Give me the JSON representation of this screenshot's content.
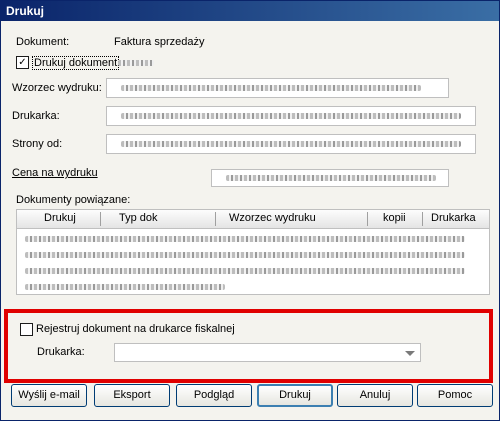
{
  "window": {
    "title": "Drukuj"
  },
  "document": {
    "label": "Dokument:",
    "value": "Faktura sprzedaży"
  },
  "print_document": {
    "label": "Drukuj dokument",
    "checked": true,
    "check_glyph": "✓"
  },
  "template": {
    "label": "Wzorzec wydruku:"
  },
  "printer": {
    "label": "Drukarka:"
  },
  "pages": {
    "label": "Strony od:"
  },
  "price_link": {
    "label": "Cena na wydruku"
  },
  "related_docs": {
    "label": "Dokumenty powiązane:",
    "columns": [
      "Drukuj",
      "Typ dok",
      "Wzorzec wydruku",
      "kopii",
      "Drukarka"
    ]
  },
  "fiscal": {
    "checkbox_label": "Rejestruj dokument na drukarce fiskalnej",
    "checked": false,
    "printer_label": "Drukarka:",
    "printer_value": ""
  },
  "buttons": {
    "email": "Wyślij e-mail",
    "export": "Eksport",
    "preview": "Podgląd",
    "print": "Drukuj",
    "cancel": "Anuluj",
    "help": "Pomoc"
  },
  "colors": {
    "title_bar": "#0a246a",
    "highlight_border": "#e00000",
    "dialog_bg": "#f4f3ee"
  }
}
